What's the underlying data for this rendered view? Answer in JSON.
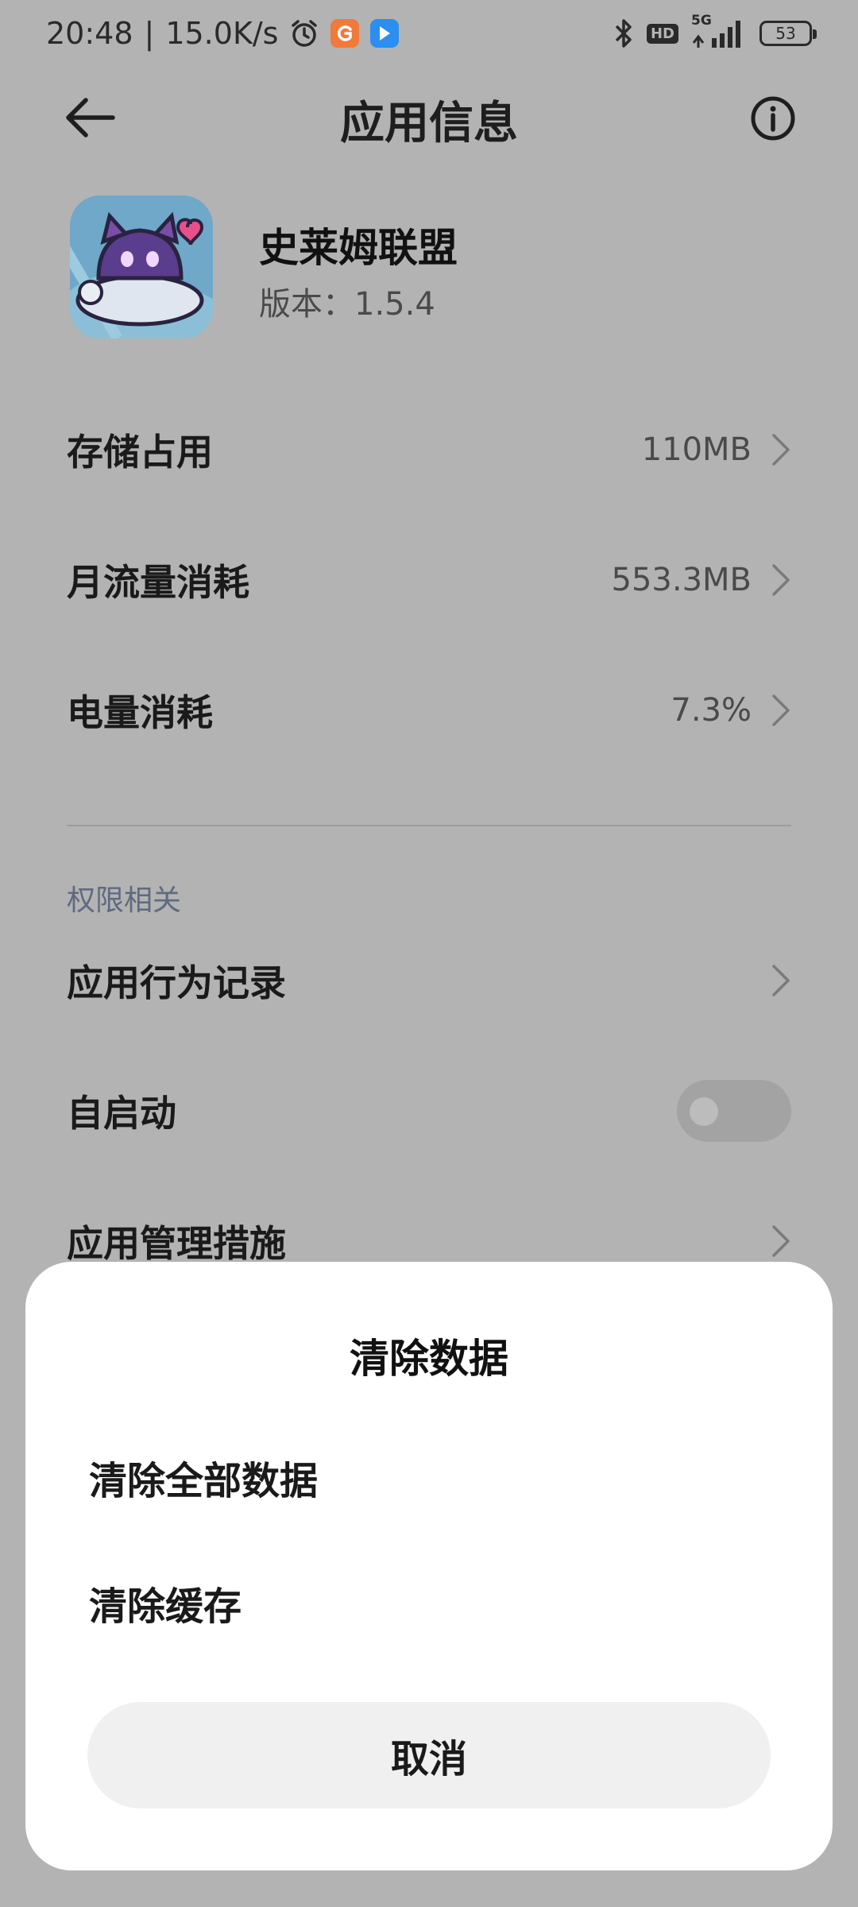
{
  "status_bar": {
    "time": "20:48",
    "separator": "|",
    "net_speed": "15.0K/s",
    "hd_label": "HD",
    "network_label": "5G",
    "battery_level": "53",
    "icons": [
      "alarm-icon",
      "orange-app-icon",
      "blue-app-icon",
      "bluetooth-icon",
      "hd-icon",
      "signal-icon",
      "battery-icon"
    ],
    "orange_badge_color": "#f07a3a",
    "blue_badge_color": "#2b8ef0"
  },
  "header": {
    "title": "应用信息"
  },
  "app": {
    "name": "史莱姆联盟",
    "version": "版本：1.5.4"
  },
  "usage_rows": [
    {
      "label": "存储占用",
      "value": "110MB"
    },
    {
      "label": "月流量消耗",
      "value": "553.3MB"
    },
    {
      "label": "电量消耗",
      "value": "7.3%"
    }
  ],
  "permissions": {
    "section_title": "权限相关",
    "rows": [
      {
        "label": "应用行为记录"
      },
      {
        "label": "自启动",
        "toggle": false
      },
      {
        "label": "应用管理措施"
      }
    ]
  },
  "dialog": {
    "title": "清除数据",
    "options": [
      "清除全部数据",
      "清除缓存"
    ],
    "cancel_label": "取消"
  },
  "colors": {
    "dim_overlay": "#b3b3b3",
    "sheet_bg": "#ffffff",
    "cancel_bg": "#f0f0f0",
    "section_title": "#5e6a80"
  }
}
